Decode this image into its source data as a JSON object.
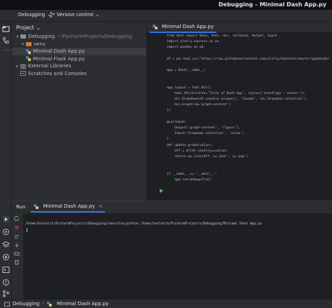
{
  "window": {
    "title": "Debugging – Minimal Dash App.py"
  },
  "toolbar": {
    "project_name": "Debugging",
    "vcs_label": "Version control"
  },
  "project_panel": {
    "header": "Project",
    "tree": [
      {
        "label": "Debugging",
        "detail": "~/PycharmProjects/Debugging",
        "level": 0,
        "expanded": true,
        "icon": "folder-icon"
      },
      {
        "label": "venv",
        "level": 1,
        "expanded": false,
        "icon": "folder-icon"
      },
      {
        "label": "Minimal Dash App.py",
        "level": 1,
        "icon": "python-file-icon",
        "selected": true
      },
      {
        "label": "Minimal Flask App.py",
        "level": 1,
        "icon": "python-file-icon"
      },
      {
        "label": "External Libraries",
        "level": 0,
        "expanded": false,
        "icon": "library-icon"
      },
      {
        "label": "Scratches and Consoles",
        "level": 0,
        "icon": "scratches-icon"
      }
    ]
  },
  "editor": {
    "tab_label": "Minimal Dash App.py",
    "lines": [
      "from dash import Dash, html, dcc, callback, Output, Input",
      "import plotly.express as px",
      "import pandas as pd",
      "",
      "df = pd.read_csv('https://raw.githubusercontent.com/plotly/datasets/master/gapminder",
      "",
      "app = Dash(__name__)",
      "",
      "",
      "app.layout = html.Div([",
      "    html.H1(children='Title of Dash App', style={'textAlign':'center'}),",
      "    dcc.Dropdown(df.country.unique(), 'Canada', id='dropdown-selection'),",
      "    dcc.Graph(id='graph-content')",
      "])",
      "",
      "@callback(",
      "    Output('graph-content', 'figure'),",
      "    Input('dropdown-selection', 'value')",
      ")",
      "def update_graph(value):",
      "    dff = df[df.country==value]",
      "    return px.line(dff, x='year', y='pop')",
      "",
      "",
      "if __name__ == '__main__':",
      "    app.run(debug=True)"
    ]
  },
  "run_panel": {
    "title": "Run",
    "tab_label": "Minimal Dash App.py",
    "output": "/home/hostatch/PycharmProjects/Debugging/venv/bin/python /home/hostatch/PycharmProjects/Debugging/Minimal Dash App.py"
  },
  "statusbar": {
    "project": "Debugging",
    "file": "Minimal Dash App.py"
  },
  "colors": {
    "accent": "#3574f0",
    "run_green": "#5fb865",
    "stop_red": "#db5c5c"
  }
}
